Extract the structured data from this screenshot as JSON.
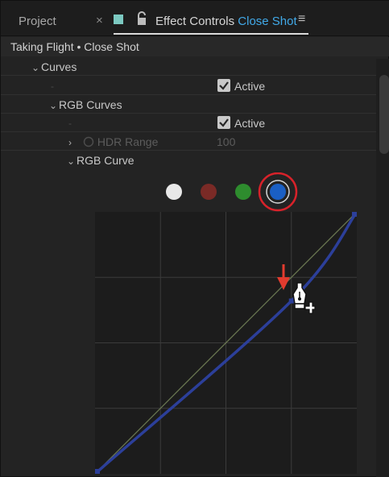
{
  "tabs": {
    "project_label": "Project",
    "close_glyph": "×",
    "effect_controls_label": "Effect Controls",
    "clip_name": "Close Shot",
    "menu_glyph": "≡",
    "accent_color": "#41a9e8"
  },
  "source": {
    "label": "Taking Flight • Close Shot"
  },
  "properties": {
    "curves_label": "Curves",
    "active_label_1": "Active",
    "rgb_curves_label": "RGB Curves",
    "active_label_2": "Active",
    "hdr_range_label": "HDR Range",
    "hdr_range_value": "100",
    "rgb_curve_label": "RGB Curve"
  },
  "channels": [
    {
      "name": "white",
      "color": "#e8e8e8"
    },
    {
      "name": "red",
      "color": "#7a2a26"
    },
    {
      "name": "green",
      "color": "#2e8c2e"
    },
    {
      "name": "blue",
      "color": "#1a5fc4",
      "selected": true
    }
  ],
  "curve": {
    "control_points": [
      [
        0,
        0
      ],
      [
        0.75,
        0.66
      ],
      [
        1,
        1
      ]
    ],
    "curve_color": "#2c3f9a",
    "diagonal_color": "#6d7a54"
  },
  "annotations": {
    "highlight_color": "#d8222a",
    "arrow_color": "#e23b2e"
  }
}
